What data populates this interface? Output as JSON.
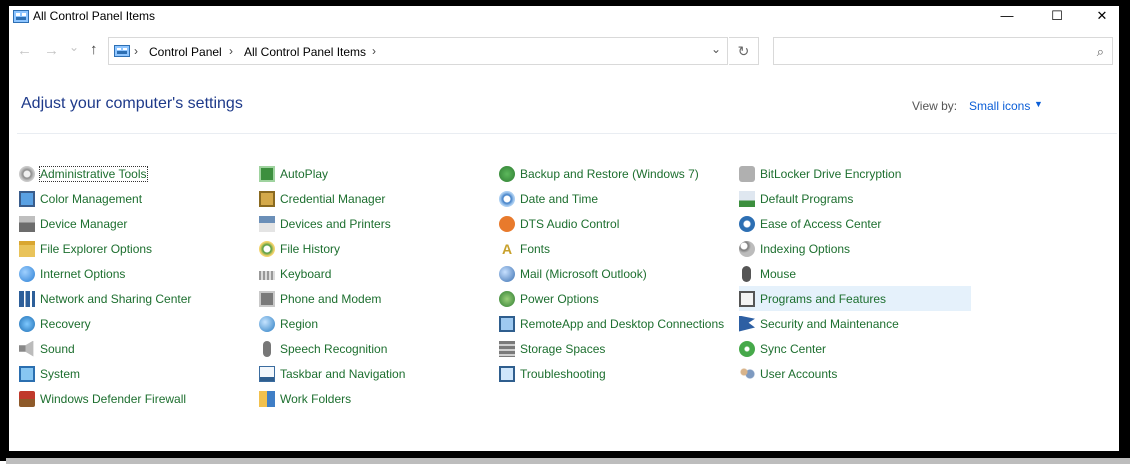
{
  "window": {
    "title": "All Control Panel Items",
    "controls": {
      "minimize": "—",
      "maximize": "☐",
      "close": "✕"
    }
  },
  "nav": {
    "back": "←",
    "forward": "→",
    "recent": "⌄",
    "up": "↑",
    "breadcrumbs": [
      "Control Panel",
      "All Control Panel Items"
    ],
    "dropdown": "⌄",
    "refresh": "↻",
    "search_placeholder": "",
    "search_icon": "⌕"
  },
  "header": {
    "title": "Adjust your computer's settings",
    "view_by_label": "View by:",
    "view_by_value": "Small icons",
    "view_by_caret": "▼"
  },
  "columns": [
    {
      "items": [
        {
          "label": "Administrative Tools",
          "icon": "admin-tools-icon",
          "iconClass": "i-gear"
        },
        {
          "label": "Color Management",
          "icon": "color-management-icon",
          "iconClass": "i-monitor"
        },
        {
          "label": "Device Manager",
          "icon": "device-manager-icon",
          "iconClass": "i-device"
        },
        {
          "label": "File Explorer Options",
          "icon": "folder-options-icon",
          "iconClass": "i-folder"
        },
        {
          "label": "Internet Options",
          "icon": "internet-options-icon",
          "iconClass": "i-globe"
        },
        {
          "label": "Network and Sharing Center",
          "icon": "network-icon",
          "iconClass": "i-network"
        },
        {
          "label": "Recovery",
          "icon": "recovery-icon",
          "iconClass": "i-recovery"
        },
        {
          "label": "Sound",
          "icon": "speaker-icon",
          "iconClass": "i-speaker"
        },
        {
          "label": "System",
          "icon": "system-icon",
          "iconClass": "i-system"
        },
        {
          "label": "Windows Defender Firewall",
          "icon": "firewall-icon",
          "iconClass": "i-firewall"
        }
      ]
    },
    {
      "items": [
        {
          "label": "AutoPlay",
          "icon": "autoplay-icon",
          "iconClass": "i-autoplay"
        },
        {
          "label": "Credential Manager",
          "icon": "credential-icon",
          "iconClass": "i-credential"
        },
        {
          "label": "Devices and Printers",
          "icon": "printer-icon",
          "iconClass": "i-printer"
        },
        {
          "label": "File History",
          "icon": "file-history-icon",
          "iconClass": "i-history"
        },
        {
          "label": "Keyboard",
          "icon": "keyboard-icon",
          "iconClass": "i-keyboard"
        },
        {
          "label": "Phone and Modem",
          "icon": "phone-icon",
          "iconClass": "i-phone"
        },
        {
          "label": "Region",
          "icon": "region-icon",
          "iconClass": "i-region"
        },
        {
          "label": "Speech Recognition",
          "icon": "microphone-icon",
          "iconClass": "i-mic"
        },
        {
          "label": "Taskbar and Navigation",
          "icon": "taskbar-icon",
          "iconClass": "i-taskbar"
        },
        {
          "label": "Work Folders",
          "icon": "work-folders-icon",
          "iconClass": "i-workfolder"
        }
      ]
    },
    {
      "items": [
        {
          "label": "Backup and Restore (Windows 7)",
          "icon": "backup-icon",
          "iconClass": "i-backup"
        },
        {
          "label": "Date and Time",
          "icon": "clock-icon",
          "iconClass": "i-datetime"
        },
        {
          "label": "DTS Audio Control",
          "icon": "dts-audio-icon",
          "iconClass": "i-dts"
        },
        {
          "label": "Fonts",
          "icon": "fonts-icon",
          "iconClass": "i-fonts",
          "glyph": "A"
        },
        {
          "label": "Mail (Microsoft Outlook)",
          "icon": "mail-icon",
          "iconClass": "i-mail"
        },
        {
          "label": "Power Options",
          "icon": "power-icon",
          "iconClass": "i-power"
        },
        {
          "label": "RemoteApp and Desktop Connections",
          "icon": "remote-desktop-icon",
          "iconClass": "i-remote"
        },
        {
          "label": "Storage Spaces",
          "icon": "storage-icon",
          "iconClass": "i-storage"
        },
        {
          "label": "Troubleshooting",
          "icon": "troubleshooting-icon",
          "iconClass": "i-trouble"
        }
      ]
    },
    {
      "items": [
        {
          "label": "BitLocker Drive Encryption",
          "icon": "bitlocker-icon",
          "iconClass": "i-bitlocker"
        },
        {
          "label": "Default Programs",
          "icon": "default-programs-icon",
          "iconClass": "i-default"
        },
        {
          "label": "Ease of Access Center",
          "icon": "ease-of-access-icon",
          "iconClass": "i-ease"
        },
        {
          "label": "Indexing Options",
          "icon": "indexing-icon",
          "iconClass": "i-indexing"
        },
        {
          "label": "Mouse",
          "icon": "mouse-icon",
          "iconClass": "i-mouse"
        },
        {
          "label": "Programs and Features",
          "icon": "programs-icon",
          "iconClass": "i-programs",
          "selected": true
        },
        {
          "label": "Security and Maintenance",
          "icon": "flag-icon",
          "iconClass": "i-security"
        },
        {
          "label": "Sync Center",
          "icon": "sync-icon",
          "iconClass": "i-sync"
        },
        {
          "label": "User Accounts",
          "icon": "user-accounts-icon",
          "iconClass": "i-users"
        }
      ]
    }
  ]
}
